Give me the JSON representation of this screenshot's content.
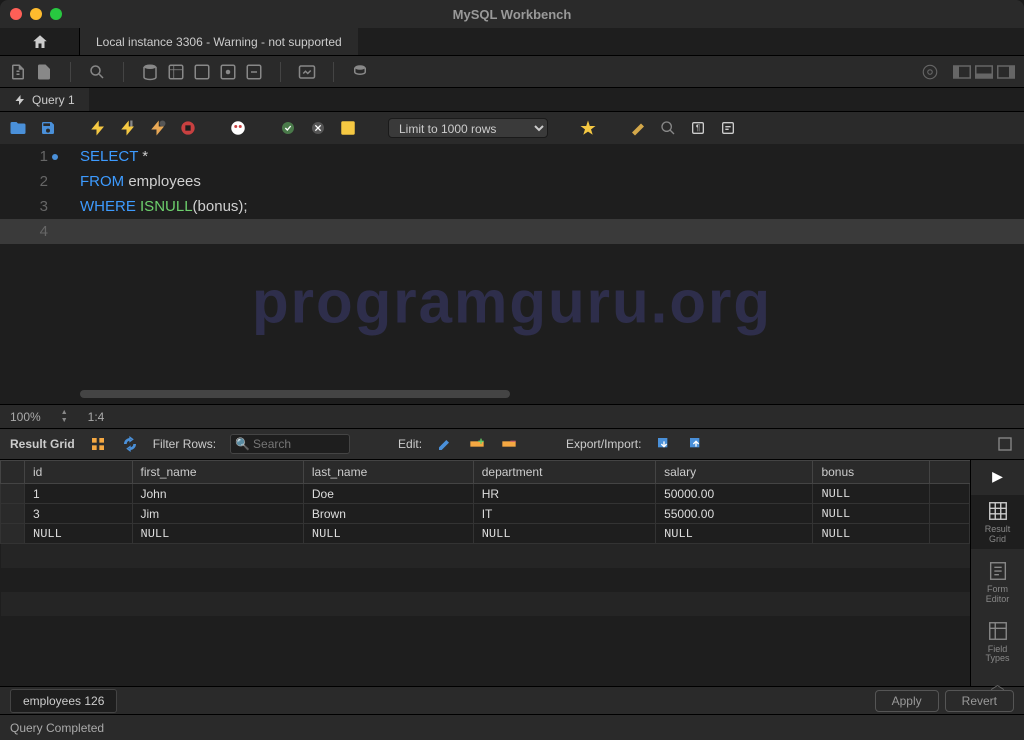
{
  "window": {
    "title": "MySQL Workbench"
  },
  "connection_tab": {
    "label": "Local instance 3306 - Warning - not supported"
  },
  "query_tab": {
    "label": "Query 1"
  },
  "editor_toolbar": {
    "limit_label": "Limit to 1000 rows"
  },
  "code_lines": {
    "l1": {
      "n": "1",
      "kw": "SELECT",
      "rest": " *"
    },
    "l2": {
      "n": "2",
      "kw": "FROM",
      "ident": " employees"
    },
    "l3": {
      "n": "3",
      "kw1": "WHERE",
      "fn": "ISNULL",
      "arg": "bonus",
      "close": ");"
    },
    "l4": {
      "n": "4"
    }
  },
  "editor_status": {
    "zoom": "100%",
    "pos": "1:4"
  },
  "watermark": "programguru.org",
  "result_toolbar": {
    "title": "Result Grid",
    "filter_label": "Filter Rows:",
    "search_placeholder": "Search",
    "edit_label": "Edit:",
    "export_label": "Export/Import:"
  },
  "columns": {
    "c0": "id",
    "c1": "first_name",
    "c2": "last_name",
    "c3": "department",
    "c4": "salary",
    "c5": "bonus"
  },
  "rows": [
    {
      "id": "1",
      "first_name": "John",
      "last_name": "Doe",
      "department": "HR",
      "salary": "50000.00",
      "bonus": "NULL"
    },
    {
      "id": "3",
      "first_name": "Jim",
      "last_name": "Brown",
      "department": "IT",
      "salary": "55000.00",
      "bonus": "NULL"
    }
  ],
  "null_text": "NULL",
  "right_panel": {
    "grid": "Result\nGrid",
    "form": "Form\nEditor",
    "types": "Field\nTypes"
  },
  "bottom": {
    "tab": "employees 126",
    "apply": "Apply",
    "revert": "Revert"
  },
  "status": {
    "text": "Query Completed"
  }
}
